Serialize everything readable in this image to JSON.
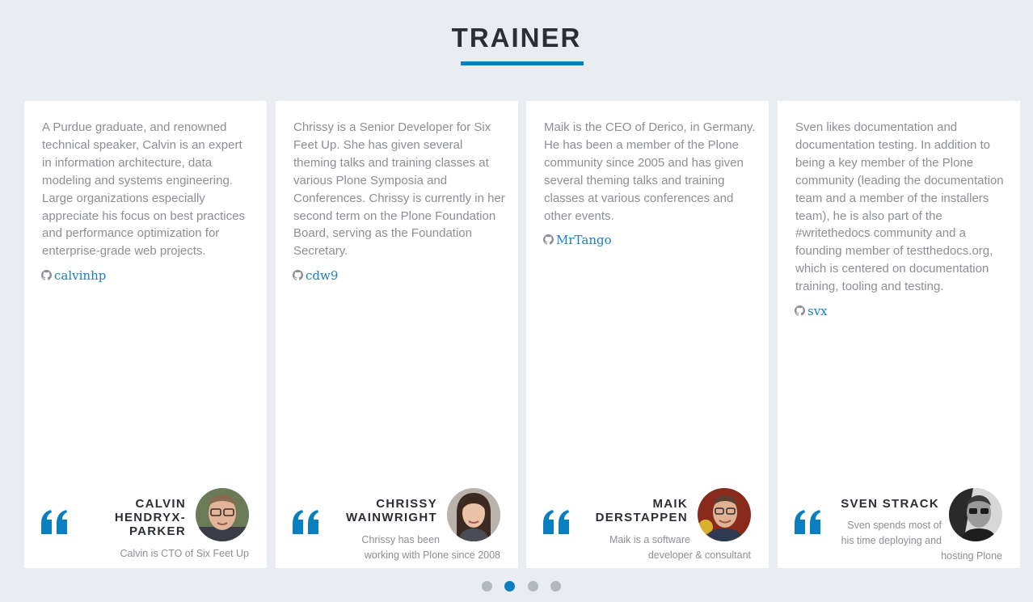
{
  "section": {
    "title": "TRAINER"
  },
  "trainers": [
    {
      "bio": "A Purdue graduate, and renowned technical speaker, Calvin is an expert in information architecture, data modeling and systems engineering. Large organizations especially appreciate his focus on best practices and performance optimization for enterprise-grade web projects.",
      "github": "calvinhp",
      "name_lines": [
        "CALVIN",
        "HENDRYX-",
        "PARKER"
      ],
      "subtitle_lines": [
        "Calvin is CTO of Six Feet Up"
      ],
      "avatar_icon": "avatar-calvin"
    },
    {
      "bio": "Chrissy is a Senior Developer for Six Feet Up. She has given several theming talks and training classes at various Plone Symposia and Conferences. Chrissy is currently in her second term on the Plone Foundation Board, serving as the Foundation Secretary.",
      "github": "cdw9",
      "name_lines": [
        "CHRISSY",
        "WAINWRIGHT"
      ],
      "subtitle_lines": [
        "Chrissy has been",
        "working with Plone since 2008"
      ],
      "avatar_icon": "avatar-chrissy"
    },
    {
      "bio": "Maik is the CEO of Derico, in Germany. He has been a member of the Plone community since 2005 and has given several theming talks and training classes at various conferences and other events.",
      "github": "MrTango",
      "name_lines": [
        "MAIK",
        "DERSTAPPEN"
      ],
      "subtitle_lines": [
        "Maik is a software",
        "developer & consultant"
      ],
      "avatar_icon": "avatar-maik"
    },
    {
      "bio": "Sven likes documentation and documentation testing. In addition to being a key member of the Plone community (leading the documentation team and a member of the installers team), he is also part of the #writethedocs community and a founding member of testthedocs.org, which is centered on documentation training, tooling and testing.",
      "github": "svx",
      "name_lines": [
        "SVEN STRACK"
      ],
      "subtitle_lines": [
        "Sven spends most of",
        "his time deploying and",
        "hosting Plone"
      ],
      "avatar_icon": "avatar-sven"
    }
  ],
  "carousel": {
    "page_count": 4,
    "active_index": 1
  },
  "colors": {
    "accent": "#0a7fc0",
    "link": "#1b7fbf",
    "text_muted": "#8c8f93",
    "heading": "#2b2f33",
    "background": "#e9edf1"
  }
}
